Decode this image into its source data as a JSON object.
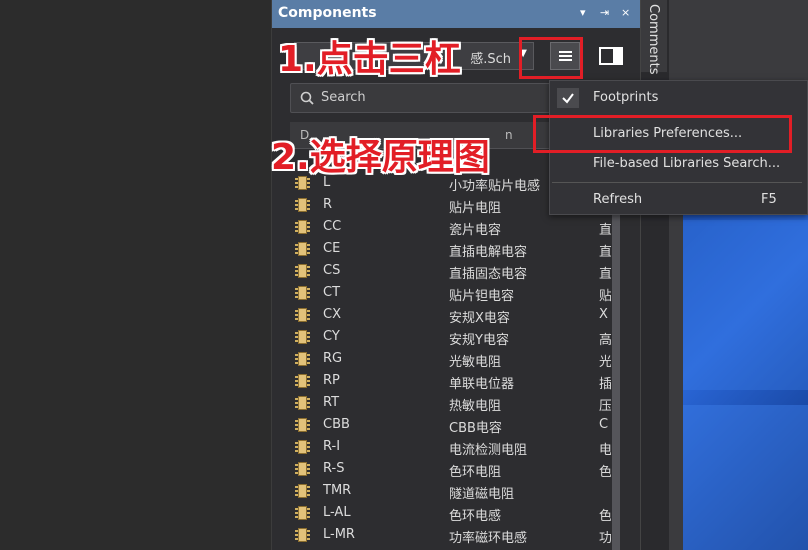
{
  "panel": {
    "title": "Components",
    "controls": [
      "▾",
      "⇥",
      "×"
    ],
    "library_select": "感.Sch",
    "search_placeholder": "Search",
    "columns": [
      "D",
      "n"
    ]
  },
  "components": [
    {
      "designator": "L",
      "desc": "小功率贴片电感",
      "extra": ""
    },
    {
      "designator": "R",
      "desc": "贴片电阻",
      "extra": ""
    },
    {
      "designator": "CC",
      "desc": "瓷片电容",
      "extra": "直"
    },
    {
      "designator": "CE",
      "desc": "直插电解电容",
      "extra": "直"
    },
    {
      "designator": "CS",
      "desc": "直插固态电容",
      "extra": "直"
    },
    {
      "designator": "CT",
      "desc": "贴片钽电容",
      "extra": "贴"
    },
    {
      "designator": "CX",
      "desc": "安规X电容",
      "extra": "X"
    },
    {
      "designator": "CY",
      "desc": "安规Y电容",
      "extra": "高"
    },
    {
      "designator": "RG",
      "desc": "光敏电阻",
      "extra": "光"
    },
    {
      "designator": "RP",
      "desc": "单联电位器",
      "extra": "插"
    },
    {
      "designator": "RT",
      "desc": "热敏电阻",
      "extra": "压"
    },
    {
      "designator": "CBB",
      "desc": "CBB电容",
      "extra": "C"
    },
    {
      "designator": "R-I",
      "desc": "电流检测电阻",
      "extra": "电"
    },
    {
      "designator": "R-S",
      "desc": "色环电阻",
      "extra": "色"
    },
    {
      "designator": "TMR",
      "desc": "隧道磁电阻",
      "extra": ""
    },
    {
      "designator": "L-AL",
      "desc": "色环电感",
      "extra": "色"
    },
    {
      "designator": "L-MR",
      "desc": "功率磁环电感",
      "extra": "功"
    }
  ],
  "side_tab": "Comments",
  "menu": {
    "items": [
      {
        "label": "Footprints",
        "shortcut": "",
        "checked": true
      },
      {
        "label": "Libraries Preferences...",
        "shortcut": "",
        "checked": false
      },
      {
        "label": "File-based Libraries Search...",
        "shortcut": "",
        "checked": false
      },
      {
        "label": "Refresh",
        "shortcut": "F5",
        "checked": false
      }
    ]
  },
  "annotations": {
    "step1": "1.点击三杠",
    "step2": "2.选择原理图"
  },
  "colors": {
    "accent_red": "#e21e26",
    "titlebar": "#5a7da6",
    "panel_bg": "#2d2d30"
  }
}
